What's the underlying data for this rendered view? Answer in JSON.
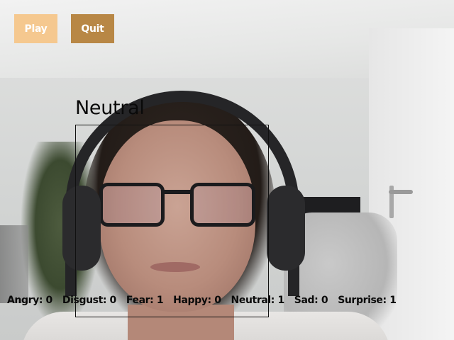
{
  "controls": {
    "play_label": "Play",
    "quit_label": "Quit",
    "play_color": "#f5c88f",
    "quit_color": "#b88745"
  },
  "detection": {
    "label": "Neutral"
  },
  "emotion_counts": [
    {
      "name": "Angry:",
      "value": "0"
    },
    {
      "name": "Disgust:",
      "value": "0"
    },
    {
      "name": "Fear:",
      "value": "1"
    },
    {
      "name": "Happy:",
      "value": "0"
    },
    {
      "name": "Neutral:",
      "value": "1"
    },
    {
      "name": "Sad:",
      "value": "0"
    },
    {
      "name": "Surprise:",
      "value": "1"
    }
  ]
}
